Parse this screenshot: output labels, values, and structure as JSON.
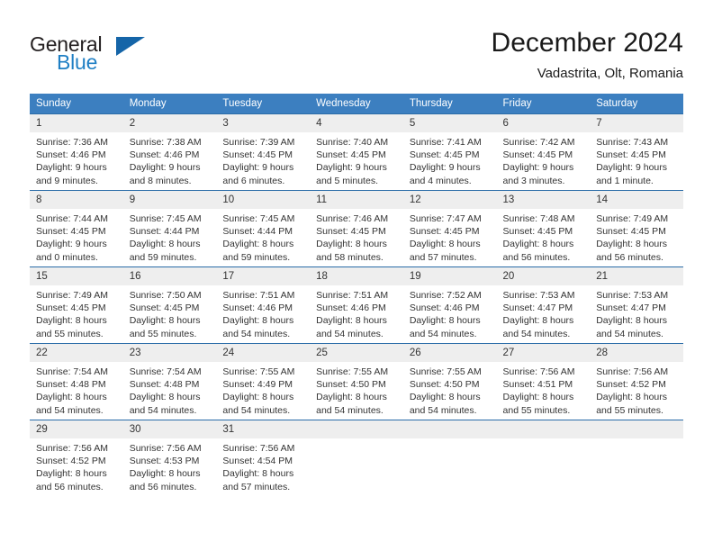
{
  "brand": {
    "word1": "General",
    "word2": "Blue",
    "triangle_icon": "brand-triangle-icon",
    "accent_color": "#1f7fc4",
    "triangle_color": "#1565a8"
  },
  "header": {
    "title": "December 2024",
    "subtitle": "Vadastrita, Olt, Romania"
  },
  "calendar": {
    "header_bg": "#3c7fc0",
    "header_text_color": "#ffffff",
    "daynum_bg": "#eeeeee",
    "row_divider_color": "#2a6ca8",
    "weekdays": [
      "Sunday",
      "Monday",
      "Tuesday",
      "Wednesday",
      "Thursday",
      "Friday",
      "Saturday"
    ],
    "weeks": [
      [
        {
          "day": "1",
          "sunrise": "Sunrise: 7:36 AM",
          "sunset": "Sunset: 4:46 PM",
          "daylight1": "Daylight: 9 hours",
          "daylight2": "and 9 minutes."
        },
        {
          "day": "2",
          "sunrise": "Sunrise: 7:38 AM",
          "sunset": "Sunset: 4:46 PM",
          "daylight1": "Daylight: 9 hours",
          "daylight2": "and 8 minutes."
        },
        {
          "day": "3",
          "sunrise": "Sunrise: 7:39 AM",
          "sunset": "Sunset: 4:45 PM",
          "daylight1": "Daylight: 9 hours",
          "daylight2": "and 6 minutes."
        },
        {
          "day": "4",
          "sunrise": "Sunrise: 7:40 AM",
          "sunset": "Sunset: 4:45 PM",
          "daylight1": "Daylight: 9 hours",
          "daylight2": "and 5 minutes."
        },
        {
          "day": "5",
          "sunrise": "Sunrise: 7:41 AM",
          "sunset": "Sunset: 4:45 PM",
          "daylight1": "Daylight: 9 hours",
          "daylight2": "and 4 minutes."
        },
        {
          "day": "6",
          "sunrise": "Sunrise: 7:42 AM",
          "sunset": "Sunset: 4:45 PM",
          "daylight1": "Daylight: 9 hours",
          "daylight2": "and 3 minutes."
        },
        {
          "day": "7",
          "sunrise": "Sunrise: 7:43 AM",
          "sunset": "Sunset: 4:45 PM",
          "daylight1": "Daylight: 9 hours",
          "daylight2": "and 1 minute."
        }
      ],
      [
        {
          "day": "8",
          "sunrise": "Sunrise: 7:44 AM",
          "sunset": "Sunset: 4:45 PM",
          "daylight1": "Daylight: 9 hours",
          "daylight2": "and 0 minutes."
        },
        {
          "day": "9",
          "sunrise": "Sunrise: 7:45 AM",
          "sunset": "Sunset: 4:44 PM",
          "daylight1": "Daylight: 8 hours",
          "daylight2": "and 59 minutes."
        },
        {
          "day": "10",
          "sunrise": "Sunrise: 7:45 AM",
          "sunset": "Sunset: 4:44 PM",
          "daylight1": "Daylight: 8 hours",
          "daylight2": "and 59 minutes."
        },
        {
          "day": "11",
          "sunrise": "Sunrise: 7:46 AM",
          "sunset": "Sunset: 4:45 PM",
          "daylight1": "Daylight: 8 hours",
          "daylight2": "and 58 minutes."
        },
        {
          "day": "12",
          "sunrise": "Sunrise: 7:47 AM",
          "sunset": "Sunset: 4:45 PM",
          "daylight1": "Daylight: 8 hours",
          "daylight2": "and 57 minutes."
        },
        {
          "day": "13",
          "sunrise": "Sunrise: 7:48 AM",
          "sunset": "Sunset: 4:45 PM",
          "daylight1": "Daylight: 8 hours",
          "daylight2": "and 56 minutes."
        },
        {
          "day": "14",
          "sunrise": "Sunrise: 7:49 AM",
          "sunset": "Sunset: 4:45 PM",
          "daylight1": "Daylight: 8 hours",
          "daylight2": "and 56 minutes."
        }
      ],
      [
        {
          "day": "15",
          "sunrise": "Sunrise: 7:49 AM",
          "sunset": "Sunset: 4:45 PM",
          "daylight1": "Daylight: 8 hours",
          "daylight2": "and 55 minutes."
        },
        {
          "day": "16",
          "sunrise": "Sunrise: 7:50 AM",
          "sunset": "Sunset: 4:45 PM",
          "daylight1": "Daylight: 8 hours",
          "daylight2": "and 55 minutes."
        },
        {
          "day": "17",
          "sunrise": "Sunrise: 7:51 AM",
          "sunset": "Sunset: 4:46 PM",
          "daylight1": "Daylight: 8 hours",
          "daylight2": "and 54 minutes."
        },
        {
          "day": "18",
          "sunrise": "Sunrise: 7:51 AM",
          "sunset": "Sunset: 4:46 PM",
          "daylight1": "Daylight: 8 hours",
          "daylight2": "and 54 minutes."
        },
        {
          "day": "19",
          "sunrise": "Sunrise: 7:52 AM",
          "sunset": "Sunset: 4:46 PM",
          "daylight1": "Daylight: 8 hours",
          "daylight2": "and 54 minutes."
        },
        {
          "day": "20",
          "sunrise": "Sunrise: 7:53 AM",
          "sunset": "Sunset: 4:47 PM",
          "daylight1": "Daylight: 8 hours",
          "daylight2": "and 54 minutes."
        },
        {
          "day": "21",
          "sunrise": "Sunrise: 7:53 AM",
          "sunset": "Sunset: 4:47 PM",
          "daylight1": "Daylight: 8 hours",
          "daylight2": "and 54 minutes."
        }
      ],
      [
        {
          "day": "22",
          "sunrise": "Sunrise: 7:54 AM",
          "sunset": "Sunset: 4:48 PM",
          "daylight1": "Daylight: 8 hours",
          "daylight2": "and 54 minutes."
        },
        {
          "day": "23",
          "sunrise": "Sunrise: 7:54 AM",
          "sunset": "Sunset: 4:48 PM",
          "daylight1": "Daylight: 8 hours",
          "daylight2": "and 54 minutes."
        },
        {
          "day": "24",
          "sunrise": "Sunrise: 7:55 AM",
          "sunset": "Sunset: 4:49 PM",
          "daylight1": "Daylight: 8 hours",
          "daylight2": "and 54 minutes."
        },
        {
          "day": "25",
          "sunrise": "Sunrise: 7:55 AM",
          "sunset": "Sunset: 4:50 PM",
          "daylight1": "Daylight: 8 hours",
          "daylight2": "and 54 minutes."
        },
        {
          "day": "26",
          "sunrise": "Sunrise: 7:55 AM",
          "sunset": "Sunset: 4:50 PM",
          "daylight1": "Daylight: 8 hours",
          "daylight2": "and 54 minutes."
        },
        {
          "day": "27",
          "sunrise": "Sunrise: 7:56 AM",
          "sunset": "Sunset: 4:51 PM",
          "daylight1": "Daylight: 8 hours",
          "daylight2": "and 55 minutes."
        },
        {
          "day": "28",
          "sunrise": "Sunrise: 7:56 AM",
          "sunset": "Sunset: 4:52 PM",
          "daylight1": "Daylight: 8 hours",
          "daylight2": "and 55 minutes."
        }
      ],
      [
        {
          "day": "29",
          "sunrise": "Sunrise: 7:56 AM",
          "sunset": "Sunset: 4:52 PM",
          "daylight1": "Daylight: 8 hours",
          "daylight2": "and 56 minutes."
        },
        {
          "day": "30",
          "sunrise": "Sunrise: 7:56 AM",
          "sunset": "Sunset: 4:53 PM",
          "daylight1": "Daylight: 8 hours",
          "daylight2": "and 56 minutes."
        },
        {
          "day": "31",
          "sunrise": "Sunrise: 7:56 AM",
          "sunset": "Sunset: 4:54 PM",
          "daylight1": "Daylight: 8 hours",
          "daylight2": "and 57 minutes."
        },
        {
          "day": "",
          "sunrise": "",
          "sunset": "",
          "daylight1": "",
          "daylight2": "",
          "empty": true
        },
        {
          "day": "",
          "sunrise": "",
          "sunset": "",
          "daylight1": "",
          "daylight2": "",
          "empty": true
        },
        {
          "day": "",
          "sunrise": "",
          "sunset": "",
          "daylight1": "",
          "daylight2": "",
          "empty": true
        },
        {
          "day": "",
          "sunrise": "",
          "sunset": "",
          "daylight1": "",
          "daylight2": "",
          "empty": true
        }
      ]
    ]
  }
}
